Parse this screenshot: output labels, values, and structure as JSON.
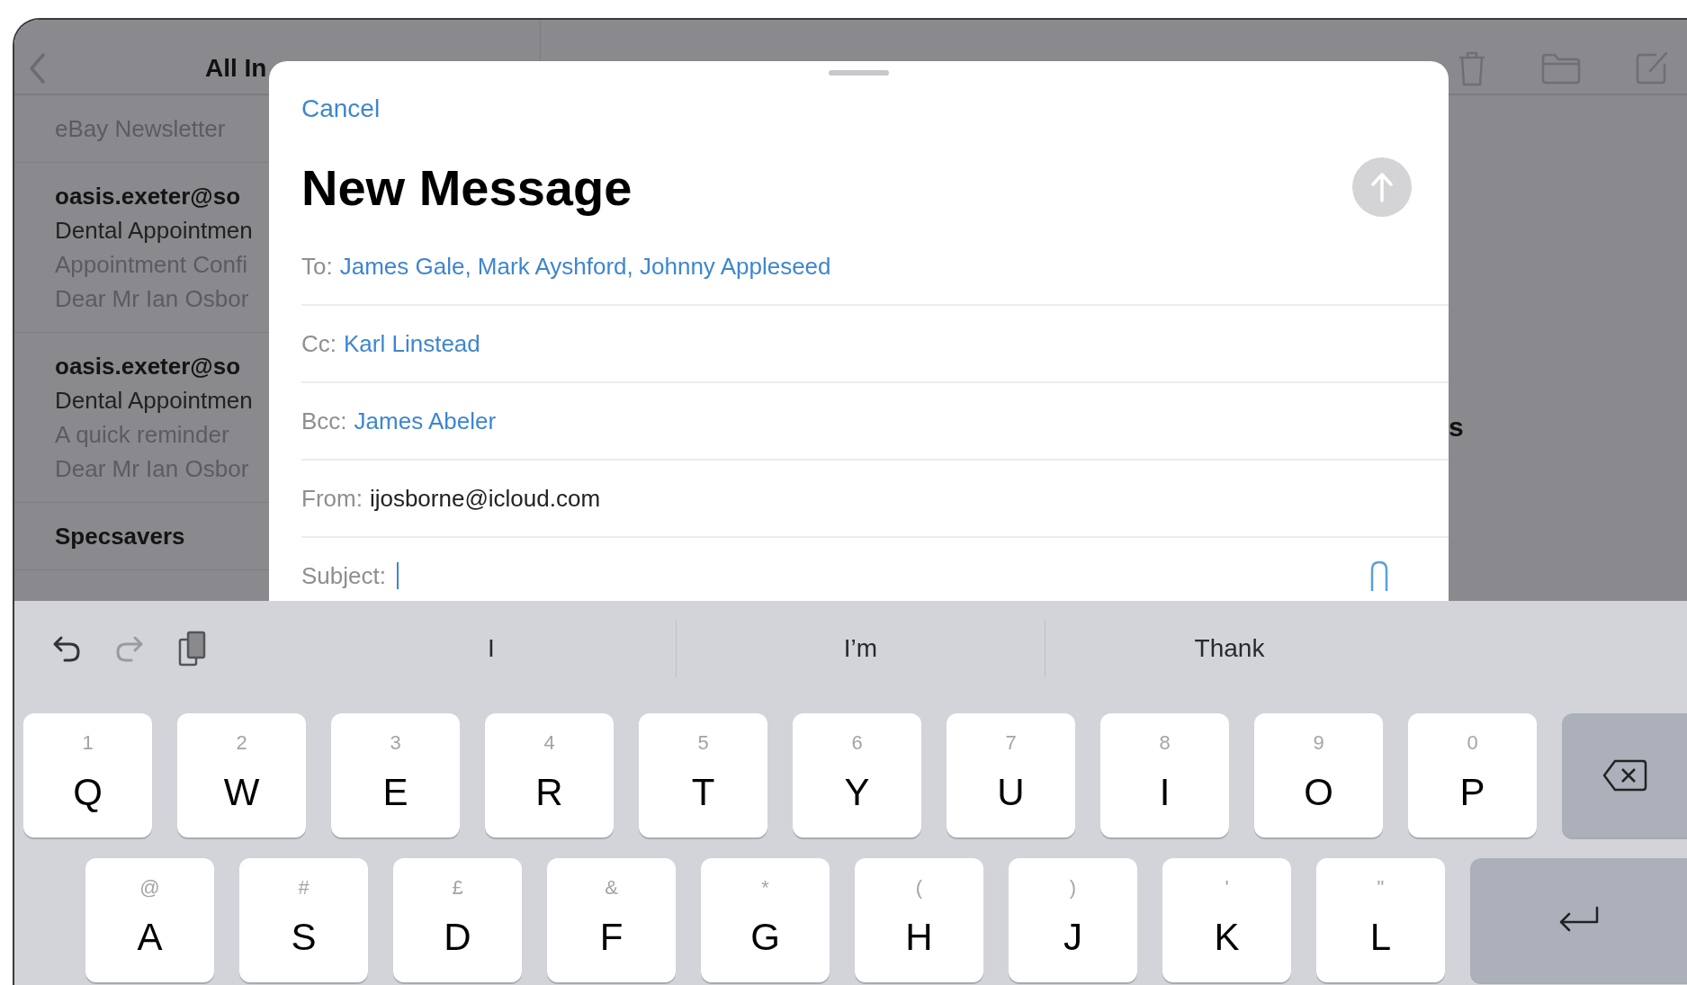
{
  "mailbox": {
    "title": "All In",
    "messages": [
      {
        "preview": "eBay Newsletter"
      },
      {
        "sender": "oasis.exeter@so",
        "subject": "Dental Appointmen",
        "preview": "Appointment Confi",
        "snippet": "Dear Mr Ian Osbor"
      },
      {
        "sender": "oasis.exeter@so",
        "subject": "Dental Appointmen",
        "preview": "A quick reminder",
        "snippet": "Dear Mr Ian Osbor"
      },
      {
        "sender": "Specsavers"
      }
    ]
  },
  "message_view": {
    "heading": "s"
  },
  "compose": {
    "cancel": "Cancel",
    "title": "New Message",
    "send_button": {
      "disabled": true
    },
    "fields": [
      {
        "kind": "recipients",
        "label": "To:",
        "value": "James Gale, Mark Ayshford, Johnny Appleseed"
      },
      {
        "kind": "recipients",
        "label": "Cc:",
        "value": "Karl Linstead"
      },
      {
        "kind": "recipients",
        "label": "Bcc:",
        "value": "James Abeler"
      },
      {
        "kind": "sender",
        "label": "From:",
        "value": "ijosborne@icloud.com"
      },
      {
        "kind": "subject",
        "label": "Subject:"
      }
    ]
  },
  "keyboard": {
    "toolbar": {
      "undo": {
        "disabled": false
      },
      "redo": {
        "disabled": true
      }
    },
    "suggestions": [
      "I",
      "I’m",
      "Thank"
    ],
    "rows": [
      {
        "keys": [
          {
            "kind": "letter",
            "label": "Q",
            "secondary": "1"
          },
          {
            "kind": "letter",
            "label": "W",
            "secondary": "2"
          },
          {
            "kind": "letter",
            "label": "E",
            "secondary": "3"
          },
          {
            "kind": "letter",
            "label": "R",
            "secondary": "4"
          },
          {
            "kind": "letter",
            "label": "T",
            "secondary": "5"
          },
          {
            "kind": "letter",
            "label": "Y",
            "secondary": "6"
          },
          {
            "kind": "letter",
            "label": "U",
            "secondary": "7"
          },
          {
            "kind": "letter",
            "label": "I",
            "secondary": "8"
          },
          {
            "kind": "letter",
            "label": "O",
            "secondary": "9"
          },
          {
            "kind": "letter",
            "label": "P",
            "secondary": "0"
          },
          {
            "kind": "delete"
          }
        ]
      },
      {
        "keys": [
          {
            "kind": "letter",
            "label": "A",
            "secondary": "@"
          },
          {
            "kind": "letter",
            "label": "S",
            "secondary": "#"
          },
          {
            "kind": "letter",
            "label": "D",
            "secondary": "£"
          },
          {
            "kind": "letter",
            "label": "F",
            "secondary": "&"
          },
          {
            "kind": "letter",
            "label": "G",
            "secondary": "*"
          },
          {
            "kind": "letter",
            "label": "H",
            "secondary": "("
          },
          {
            "kind": "letter",
            "label": "J",
            "secondary": ")"
          },
          {
            "kind": "letter",
            "label": "K",
            "secondary": "'"
          },
          {
            "kind": "letter",
            "label": "L",
            "secondary": "\""
          },
          {
            "kind": "return"
          }
        ]
      }
    ]
  }
}
